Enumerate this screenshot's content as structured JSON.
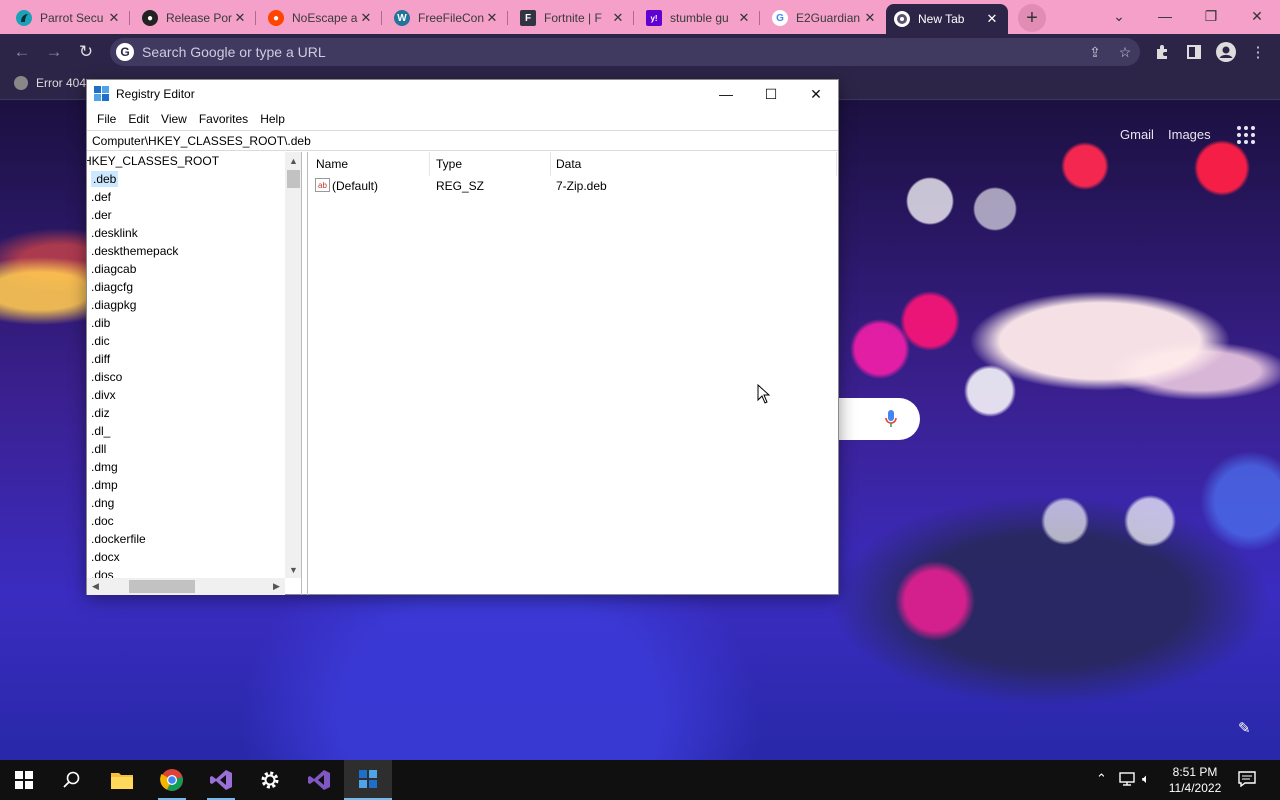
{
  "browser": {
    "tabs": [
      {
        "title": "Parrot Secu",
        "color": "#1aa3b8",
        "glyph": ""
      },
      {
        "title": "Release Por",
        "color": "#222222",
        "glyph": ""
      },
      {
        "title": "NoEscape a",
        "color": "#ff4500",
        "glyph": ""
      },
      {
        "title": "FreeFileCon",
        "color": "#21759b",
        "glyph": ""
      },
      {
        "title": "Fortnite | F",
        "color": "#333344",
        "glyph": "F"
      },
      {
        "title": "stumble gu",
        "color": "#6001d2",
        "glyph": "y!"
      },
      {
        "title": "E2Guardian",
        "color": "#ffffff",
        "glyph": "G"
      },
      {
        "title": "New Tab",
        "color": "#ffffff",
        "glyph": ""
      }
    ],
    "omnibox_placeholder": "Search Google or type a URL",
    "bookmark": "Error 404"
  },
  "page": {
    "gmail": "Gmail",
    "images": "Images"
  },
  "regedit": {
    "title": "Registry Editor",
    "menu": [
      "File",
      "Edit",
      "View",
      "Favorites",
      "Help"
    ],
    "address": "Computer\\HKEY_CLASSES_ROOT\\.deb",
    "tree_root": "HKEY_CLASSES_ROOT",
    "tree": [
      ".deb",
      ".def",
      ".der",
      ".desklink",
      ".deskthemepack",
      ".diagcab",
      ".diagcfg",
      ".diagpkg",
      ".dib",
      ".dic",
      ".diff",
      ".disco",
      ".divx",
      ".diz",
      ".dl_",
      ".dll",
      ".dmg",
      ".dmp",
      ".dng",
      ".doc",
      ".dockerfile",
      ".docx",
      ".dos"
    ],
    "selected": ".deb",
    "columns": [
      "Name",
      "Type",
      "Data"
    ],
    "values": [
      {
        "name": "(Default)",
        "type": "REG_SZ",
        "data": "7-Zip.deb"
      }
    ]
  },
  "taskbar": {
    "time": "8:51 PM",
    "date": "11/4/2022"
  }
}
